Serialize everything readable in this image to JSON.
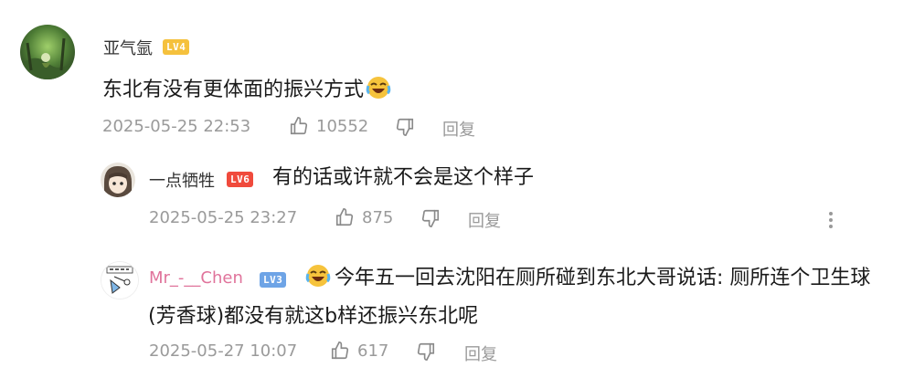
{
  "comments": [
    {
      "username": "亚气氩",
      "level": "LV4",
      "text": "东北有没有更体面的振兴方式",
      "timestamp": "2025-05-25 22:53",
      "likes": "10552",
      "reply_label": "回复",
      "avatar_icon": "forest-avatar",
      "emoji_icon": "laughing-crying-emoji"
    },
    {
      "username": "一点牺牲",
      "level": "LV6",
      "text": "有的话或许就不会是这个样子",
      "timestamp": "2025-05-25 23:27",
      "likes": "875",
      "reply_label": "回复",
      "avatar_icon": "anime-girl-avatar"
    },
    {
      "username": "Mr_-__Chen",
      "level": "LV3",
      "text_line1": "今年五一回去沈阳在厕所碰到东北大哥说话: 厕所连个卫生球",
      "text_line2": "(芳香球)都没有就这b样还振兴东北呢",
      "timestamp": "2025-05-27 10:07",
      "likes": "617",
      "reply_label": "回复",
      "avatar_icon": "cartoon-sign-avatar",
      "emoji_icon": "laughing-crying-emoji"
    }
  ],
  "colors": {
    "lv4": "#f5c13d",
    "lv6": "#f04a3c",
    "lv3": "#6ea4e6",
    "username_pink": "#e0739b",
    "meta_gray": "#9a9a9a"
  }
}
